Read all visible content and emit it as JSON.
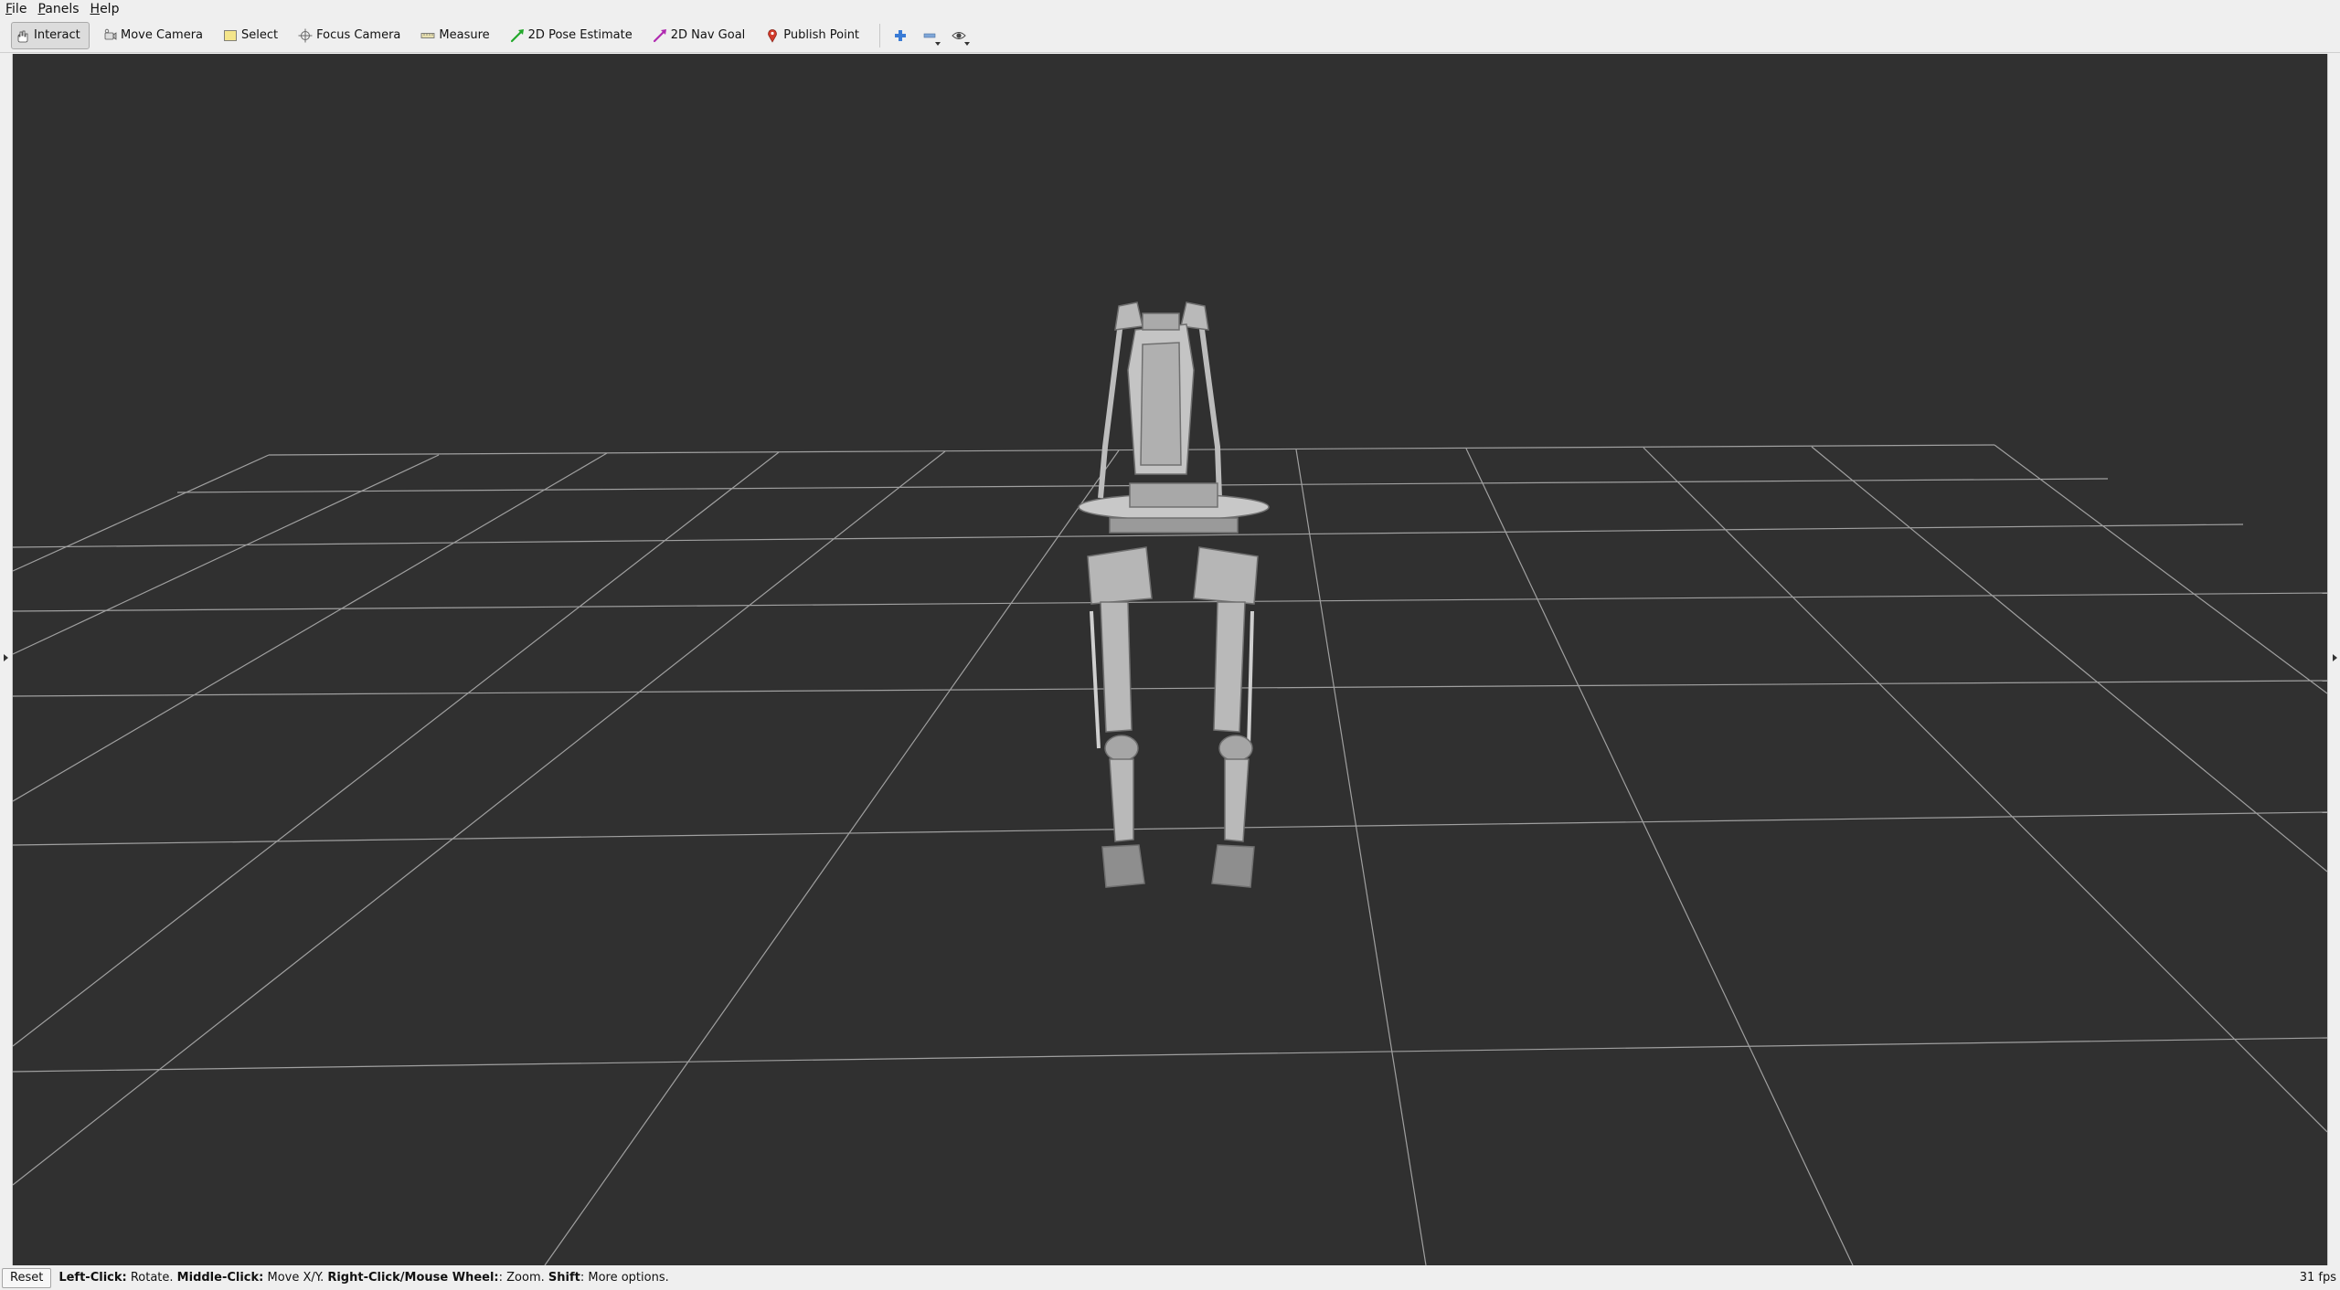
{
  "menubar": {
    "items": [
      {
        "name": "file",
        "mnemonic": "F",
        "rest": "ile"
      },
      {
        "name": "panels",
        "mnemonic": "P",
        "rest": "anels"
      },
      {
        "name": "help",
        "mnemonic": "H",
        "rest": "elp"
      }
    ]
  },
  "toolbar": {
    "interact": "Interact",
    "move_camera": "Move Camera",
    "select": "Select",
    "focus_camera": "Focus Camera",
    "measure": "Measure",
    "pose_estimate": "2D Pose Estimate",
    "nav_goal": "2D Nav Goal",
    "publish_point": "Publish Point",
    "icons": [
      "interact-hand-icon",
      "move-camera-icon",
      "select-icon",
      "focus-camera-icon",
      "measure-ruler-icon",
      "pose-estimate-arrow-icon",
      "nav-goal-arrow-icon",
      "publish-point-pin-icon",
      "add-tool-plus-icon",
      "remove-tool-minus-icon",
      "view-eye-icon"
    ],
    "colors": {
      "pose_estimate": "#22a82a",
      "nav_goal": "#b02ab0",
      "publish_point": "#d03a2a",
      "plus": "#3a7bd5"
    }
  },
  "viewport": {
    "background": "#303030",
    "grid_color": "#a0a0a0",
    "robot_color": "#b9b9b9"
  },
  "statusbar": {
    "reset_label": "Reset",
    "hint": [
      {
        "bold": "Left-Click:",
        "text": " Rotate. "
      },
      {
        "bold": "Middle-Click:",
        "text": " Move X/Y. "
      },
      {
        "bold": "Right-Click/Mouse Wheel:",
        "text": ": Zoom. "
      },
      {
        "bold": "Shift",
        "text": ": More options."
      }
    ],
    "fps": "31 fps"
  }
}
